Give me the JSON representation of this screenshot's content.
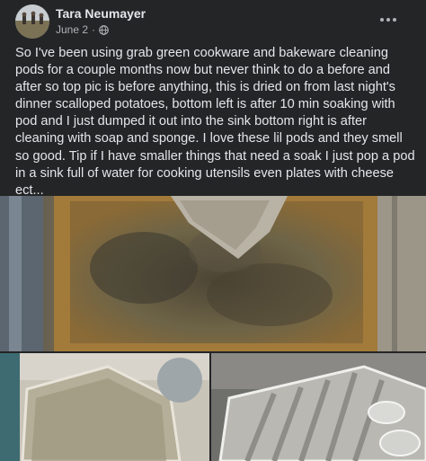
{
  "post": {
    "author": "Tara Neumayer",
    "date": "June 2",
    "separator": "·",
    "privacy_icon": "globe-icon",
    "more_icon": "more-options-icon",
    "text": "So I've been using grab green cookware and bakeware cleaning pods for a couple months now but never think to do a before and after so top pic is before anything, this is dried on from last night's dinner scalloped potatoes, bottom left is after 10 min soaking with pod and I just dumped it out into the sink bottom right is after cleaning with soap and sponge. I love these lil pods and they smell so good. Tip if I have smaller things that need a soak I just pop a pod in a sink full of water for cooking utensils even plates with cheese ect..."
  },
  "colors": {
    "background": "#242526",
    "primary_text": "#e4e6eb",
    "secondary_text": "#b0b3b8"
  }
}
